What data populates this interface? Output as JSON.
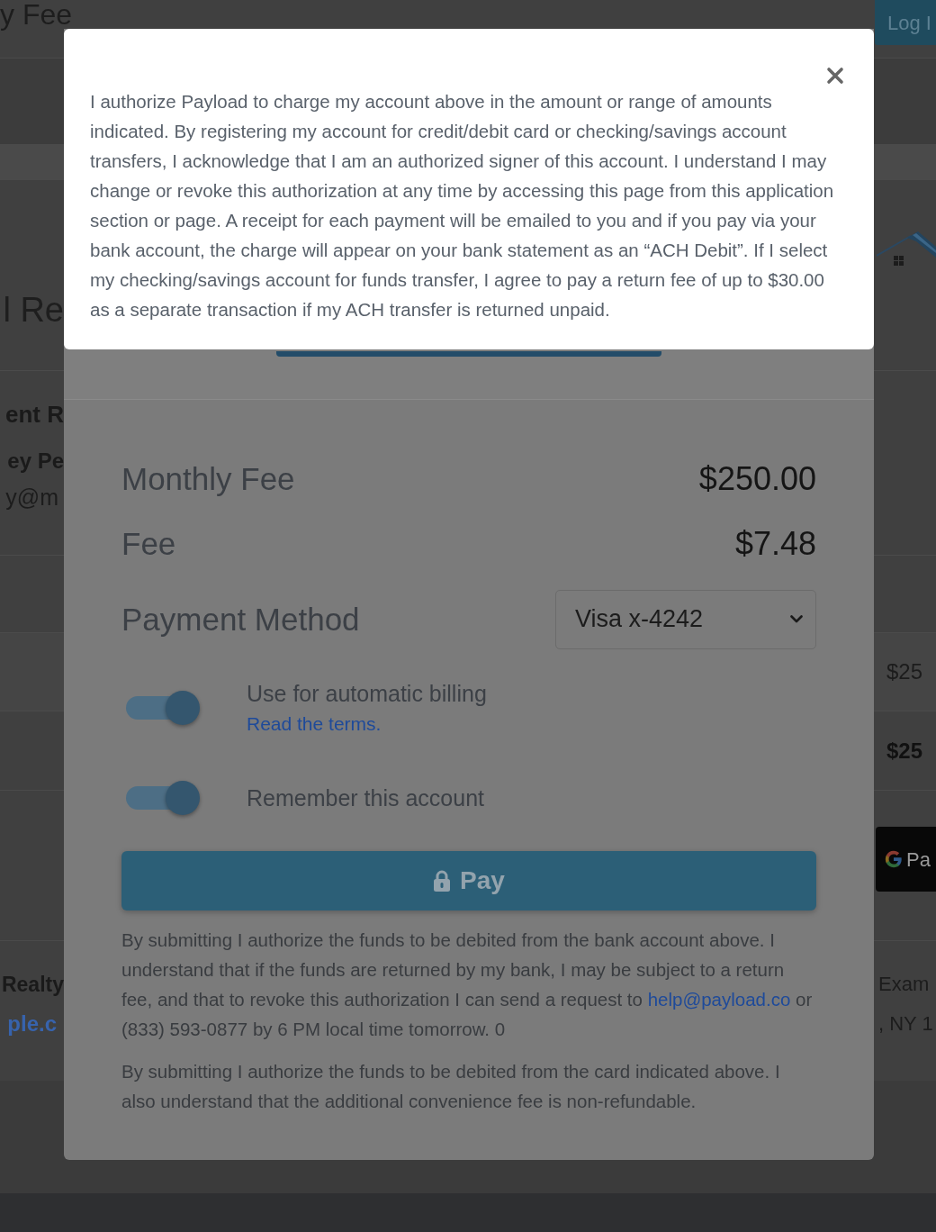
{
  "background_page": {
    "header": {
      "title": "y Fee",
      "login_button": "Log I"
    },
    "section_heading": "l Re",
    "contact": {
      "heading": "ent R",
      "name": "ey Pe",
      "email": "y@m"
    },
    "amounts": [
      {
        "kind": "regular",
        "text": "$25"
      },
      {
        "kind": "total",
        "text": "$25"
      }
    ],
    "payment_button": {
      "label": "Pa"
    },
    "company": {
      "name": "Realty",
      "website": "ple.c"
    },
    "address": [
      "Exam",
      ", NY 1"
    ]
  },
  "payment_dialog": {
    "charges": [
      {
        "label": "Monthly Fee",
        "amount": "$250.00"
      },
      {
        "label": "Fee",
        "amount": "$7.48"
      }
    ],
    "payment_method": {
      "label": "Payment Method",
      "value": "Visa x-4242"
    },
    "toggles": [
      {
        "label": "Use for automatic billing",
        "on": true,
        "link": "Read the terms."
      },
      {
        "label": "Remember this account",
        "on": true
      }
    ],
    "pay_button": {
      "label": "Pay"
    },
    "notes": [
      {
        "kind": "with_link",
        "before": "By submitting I authorize the funds to be debited from the bank account above. I understand that if the funds are returned by my bank, I may be subject to a return fee, and that to revoke this authorization I can send a request to",
        "link": "help@payload.co",
        "after": "or (833) 593-0877 by 6 PM local time tomorrow. 0"
      },
      {
        "kind": "plain",
        "text": "By submitting I authorize the funds to be debited from the card indicated above. I also understand that the additional convenience fee is non-refundable."
      }
    ]
  },
  "terms_dialog": {
    "text": "I authorize Payload to charge my account above in the amount or range of amounts indicated. By registering my account for credit/debit card or checking/savings account transfers, I acknowledge that I am an authorized signer of this account. I understand I may change or revoke this authorization at any time by accessing this page from this application section or page. A receipt for each payment will be emailed to you and if you pay via your bank account, the charge will appear on your bank statement as an “ACH Debit”. If I select my checking/savings account for funds transfer, I agree to pay a return fee of up to $30.00 as a separate transaction if my ACH transfer is returned unpaid."
  }
}
